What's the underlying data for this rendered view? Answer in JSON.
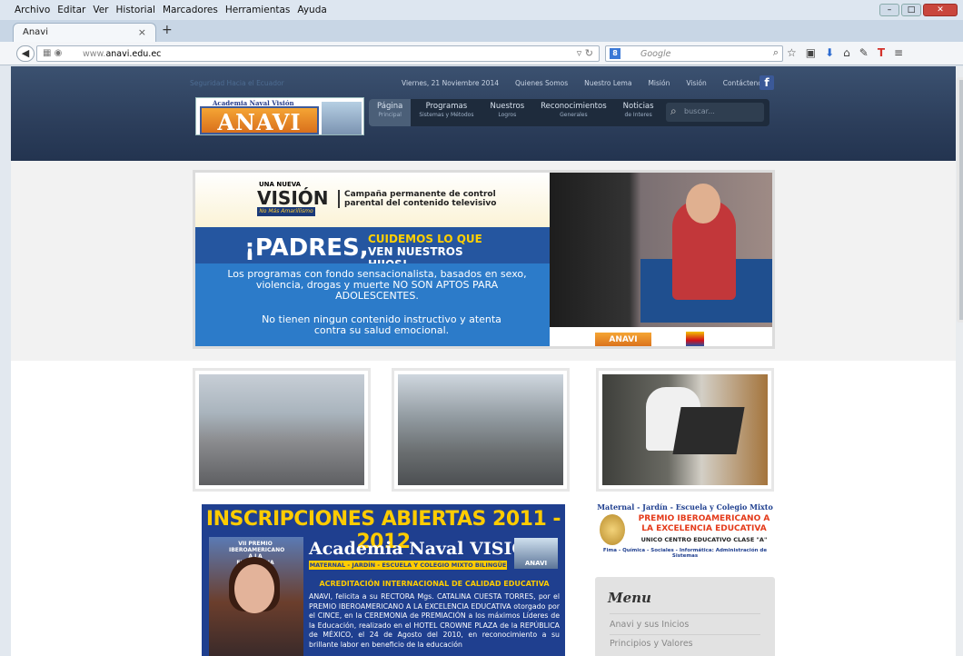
{
  "browser": {
    "menu": [
      "Archivo",
      "Editar",
      "Ver",
      "Historial",
      "Marcadores",
      "Herramientas",
      "Ayuda"
    ],
    "tab_title": "Anavi",
    "tab_close": "×",
    "new_tab": "+",
    "url_prefix": "www.",
    "url_domain": "anavi.edu.ec",
    "search_placeholder": "Google"
  },
  "site": {
    "tagline": "Seguridad Hacia el Ecuador",
    "date": "Viernes, 21 Noviembre 2014",
    "topnav": [
      "Quienes Somos",
      "Nuestro Lema",
      "Misión",
      "Visión",
      "Contáctenos"
    ],
    "logo_small": "Academia Naval Visión",
    "logo_big": "ANAVI",
    "mainnav": [
      {
        "label": "Página",
        "sub": "Principal"
      },
      {
        "label": "Programas",
        "sub": "Sistemas y Métodos"
      },
      {
        "label": "Nuestros",
        "sub": "Logros"
      },
      {
        "label": "Reconocimientos",
        "sub": "Generales"
      },
      {
        "label": "Noticias",
        "sub": "de Interes"
      }
    ],
    "search_placeholder": "buscar..."
  },
  "banner": {
    "una_nueva": "UNA NUEVA",
    "vision": "VISIÓN",
    "no_mas": "No Más Amarillismo",
    "campaign": "Campaña permanente de control parental del contenido televisivo",
    "padres": "¡PADRES,",
    "cuidemos_1": "CUIDEMOS LO QUE",
    "cuidemos_2": "VEN NUESTROS HIJOS!",
    "programs_text": "Los programas con fondo sensacionalista, basados en sexo, violencia, drogas y muerte NO SON APTOS PARA ADOLESCENTES.",
    "instructivo_text": "No tienen ningun contenido instructivo y atenta contra su salud emocional.",
    "logo_anavi": "ANAVI"
  },
  "inscripciones": {
    "title": "INSCRIPCIONES ABIERTAS 2011 - 2012",
    "academia": "Academia Naval VISIÓN",
    "band": "MATERNAL - JARDÍN - ESCUELA Y COLEGIO MIXTO BILINGÜE",
    "anavi": "ANAVI",
    "photo_caption": "VII PREMIO IBEROAMERICANO A LA EXCELENCIA EDUCATIVA",
    "acreditacion": "ACREDITACIÓN INTERNACIONAL DE CALIDAD EDUCATIVA",
    "text": "ANAVI, felicita a su RECTORA Mgs. CATALINA CUESTA TORRES, por el PREMIO IBEROAMERICANO A LA EXCELENCIA EDUCATIVA otorgado por el CINCE, en la CEREMONIA de PREMIACIÓN a los máximos Líderes de la Educación, realizado en el HOTEL CROWNE PLAZA de la REPÚBLICA de MÉXICO, el 24 de Agosto del 2010, en reconocimiento a su brillante labor en beneficio de la educación"
  },
  "premio": {
    "line1": "Maternal - Jardín - Escuela y Colegio Mixto",
    "line2": "PREMIO IBEROAMERICANO A LA EXCELENCIA EDUCATIVA",
    "line3": "UNICO CENTRO EDUCATIVO CLASE \"A\"",
    "line4": "Fima - Química - Sociales - Informática: Administración de Sistemas"
  },
  "menu": {
    "title": "Menu",
    "items": [
      "Anavi y sus Inicios",
      "Principios y Valores"
    ]
  },
  "colors": {
    "header": "#2c3e5b",
    "accent_orange": "#d9701c",
    "navy": "#1f3f8f",
    "yellow": "#ffcc00"
  }
}
